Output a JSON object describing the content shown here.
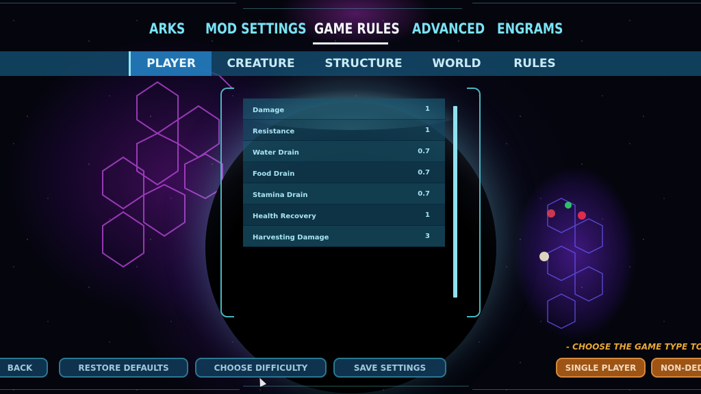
{
  "main_tabs": [
    {
      "label": "ARKS",
      "active": false
    },
    {
      "label": "MOD SETTINGS",
      "active": false
    },
    {
      "label": "GAME RULES",
      "active": true
    },
    {
      "label": "ADVANCED",
      "active": false
    },
    {
      "label": "ENGRAMS",
      "active": false
    }
  ],
  "sub_tabs": [
    {
      "label": "PLAYER",
      "active": true
    },
    {
      "label": "CREATURE",
      "active": false
    },
    {
      "label": "STRUCTURE",
      "active": false
    },
    {
      "label": "WORLD",
      "active": false
    },
    {
      "label": "RULES",
      "active": false
    }
  ],
  "settings": [
    {
      "label": "Damage",
      "value": "1"
    },
    {
      "label": "Resistance",
      "value": "1"
    },
    {
      "label": "Water Drain",
      "value": "0.7"
    },
    {
      "label": "Food Drain",
      "value": "0.7"
    },
    {
      "label": "Stamina Drain",
      "value": "0.7"
    },
    {
      "label": "Health Recovery",
      "value": "1"
    },
    {
      "label": "Harvesting Damage",
      "value": "3"
    }
  ],
  "bottom_buttons": {
    "back": "BACK",
    "restore_defaults": "RESTORE DEFAULTS",
    "choose_difficulty": "CHOOSE DIFFICULTY",
    "save_settings": "SAVE SETTINGS"
  },
  "game_type": {
    "hint": "- CHOOSE THE GAME TYPE TO CI",
    "single_player": "SINGLE PLAYER",
    "non_dedicated": "NON-DED"
  },
  "colors": {
    "tab_text": "#79e2f6",
    "active_tab_text": "#f3f6f8",
    "accent_orange": "#9e5414",
    "hint_text": "#e7a836"
  }
}
